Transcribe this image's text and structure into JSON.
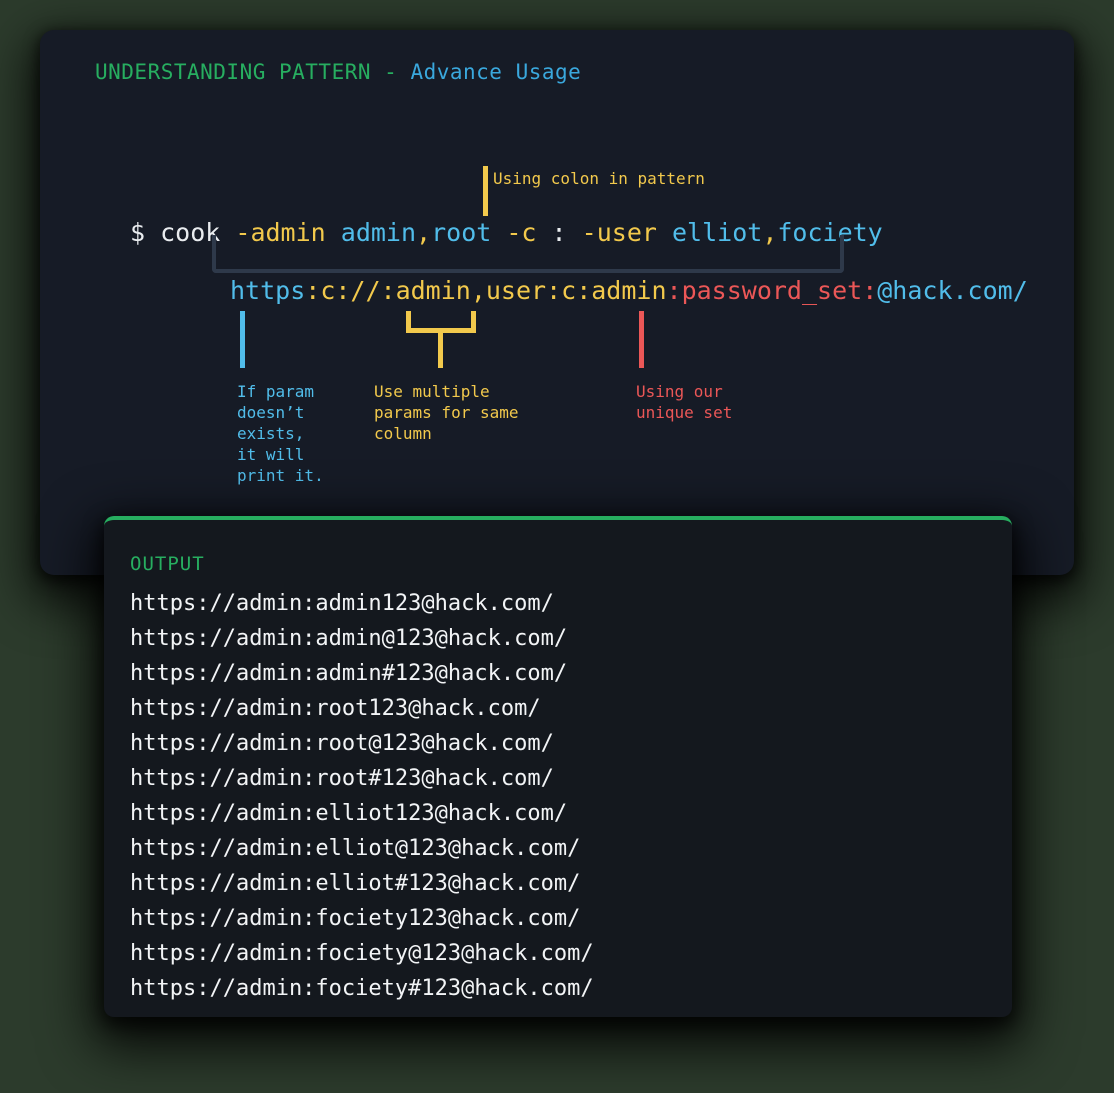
{
  "page": {
    "background_color": "#2c3b2c",
    "card_background": "#161b26",
    "output_background": "#14181e"
  },
  "colors": {
    "green": "#27ae60",
    "blue": "#51bdea",
    "title_blue": "#3aa8dd",
    "yellow": "#f2c94c",
    "red": "#eb5757",
    "white": "#e9ecef",
    "bracket_gray": "#2e394a"
  },
  "title": {
    "main": "UNDERSTANDING PATTERN",
    "dash": " - ",
    "sub": "Advance Usage"
  },
  "colon_callout": {
    "text": "Using colon in pattern"
  },
  "command": {
    "prompt": "$ ",
    "name": "cook",
    "space1": " ",
    "flag_admin": "-admin",
    "space2": " ",
    "val_admin": "admin",
    "comma1": ",",
    "val_root": "root",
    "space3": " ",
    "flag_c": "-c",
    "space4": " ",
    "colon": ":",
    "space5": " ",
    "flag_user": "-user",
    "space6": " ",
    "val_elliot": "elliot",
    "comma2": ",",
    "val_fociety": "fociety"
  },
  "pattern": {
    "scheme": "https",
    "mid": ":c://:admin,user:c:admin",
    "colon1": ":",
    "password": "password_set",
    "colon2": ":",
    "host": "@hack.com/"
  },
  "annotations": {
    "blue": "If param\ndoesn’t\nexists,\nit will\nprint it.",
    "yellow": "Use multiple\nparams for same\ncolumn",
    "red": "Using our\nunique set"
  },
  "output": {
    "label": "OUTPUT",
    "lines": [
      "https://admin:admin123@hack.com/",
      "https://admin:admin@123@hack.com/",
      "https://admin:admin#123@hack.com/",
      "https://admin:root123@hack.com/",
      "https://admin:root@123@hack.com/",
      "https://admin:root#123@hack.com/",
      "https://admin:elliot123@hack.com/",
      "https://admin:elliot@123@hack.com/",
      "https://admin:elliot#123@hack.com/",
      "https://admin:fociety123@hack.com/",
      "https://admin:fociety@123@hack.com/",
      "https://admin:fociety#123@hack.com/"
    ]
  }
}
